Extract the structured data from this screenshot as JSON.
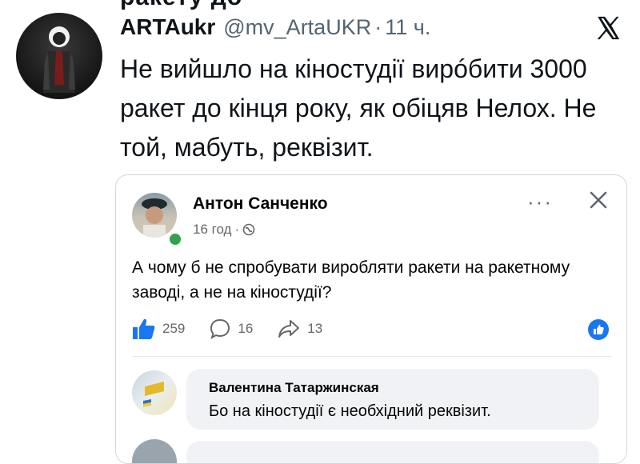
{
  "tweet": {
    "top_cut_text": "ракету до",
    "author_name": "ARTAukr",
    "author_handle": "@mv_ArtaUKR",
    "separator": "·",
    "time": "11 ч.",
    "text": "Не вийшло на кіностудії вирóбити 3000 ракет до кінця року, як обіцяв Нелох. Не той, мабуть, реквізит."
  },
  "embedded_post": {
    "author_name": "Антон Санченко",
    "meta_time": "16 год",
    "meta_separator": "·",
    "more_label": "···",
    "text": "А чому б не спробувати виробляти ракети на ракетному заводі, а не на кіностудії?",
    "reactions": {
      "likes": "259",
      "comments": "16",
      "shares": "13"
    },
    "comment": {
      "author": "Валентина Татаржинская",
      "text": "Бо на кіностудії є необхідний реквізит."
    }
  },
  "colors": {
    "x_text": "#0f1419",
    "x_muted": "#536471",
    "fb_blue": "#1877f2",
    "fb_muted": "#65676b",
    "online_green": "#31a24c",
    "comment_bg": "#f0f2f5"
  },
  "icons": [
    "x-logo-icon",
    "close-icon",
    "globe-icon",
    "like-icon",
    "comment-icon",
    "share-icon",
    "like-badge-icon"
  ]
}
